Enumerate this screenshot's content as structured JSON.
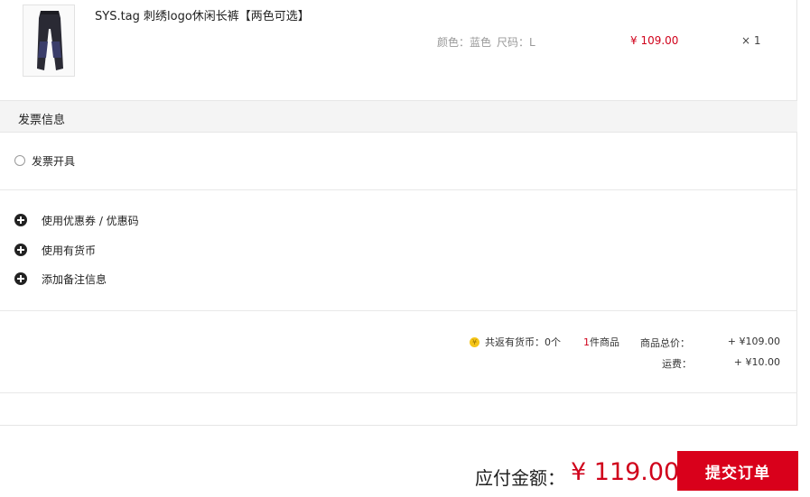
{
  "product": {
    "name": "SYS.tag 刺绣logo休闲长裤【两色可选】",
    "color_label": "颜色：蓝色",
    "size_label": "尺码：L",
    "price": "¥ 109.00",
    "quantity": "× 1",
    "image_icon": "pants-thumbnail"
  },
  "invoice": {
    "section_title": "发票信息",
    "option_label": "发票开具",
    "selected": false
  },
  "options": [
    {
      "label": "使用优惠券 / 优惠码",
      "icon": "plus-circle-icon"
    },
    {
      "label": "使用有货币",
      "icon": "plus-circle-icon"
    },
    {
      "label": "添加备注信息",
      "icon": "plus-circle-icon"
    }
  ],
  "summary": {
    "coin_icon": "yoho-coin-icon",
    "coin_text": "共返有货币：0个",
    "item_count": "1",
    "item_count_suffix": "件商品",
    "goods_total_label": "商品总价：",
    "goods_total_value": "+ ¥109.00",
    "shipping_label": "运费：",
    "shipping_value": "+ ¥10.00"
  },
  "checkout": {
    "pay_label": "应付金额：",
    "pay_amount": "¥ 119.00",
    "submit_label": "提交订单",
    "accent_color": "#d9001b"
  }
}
